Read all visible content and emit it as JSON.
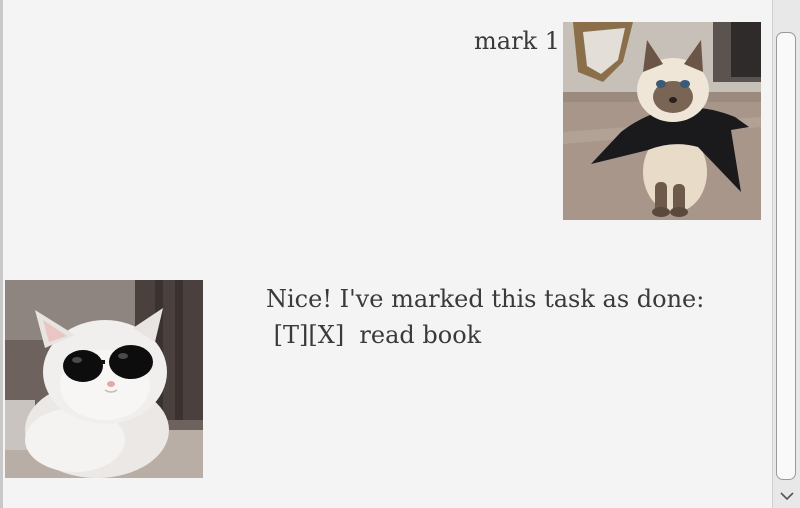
{
  "conversation": {
    "user_message": {
      "text": "mark 1",
      "avatar_icon": "siamese-cat-cape-avatar"
    },
    "bot_message": {
      "line1": "Nice! I've marked this task as done:",
      "line2": " [T][X]  read book",
      "avatar_icon": "white-cat-sunglasses-avatar"
    }
  },
  "scrollbar": {
    "arrow_down_icon": "chevron-down-icon"
  }
}
